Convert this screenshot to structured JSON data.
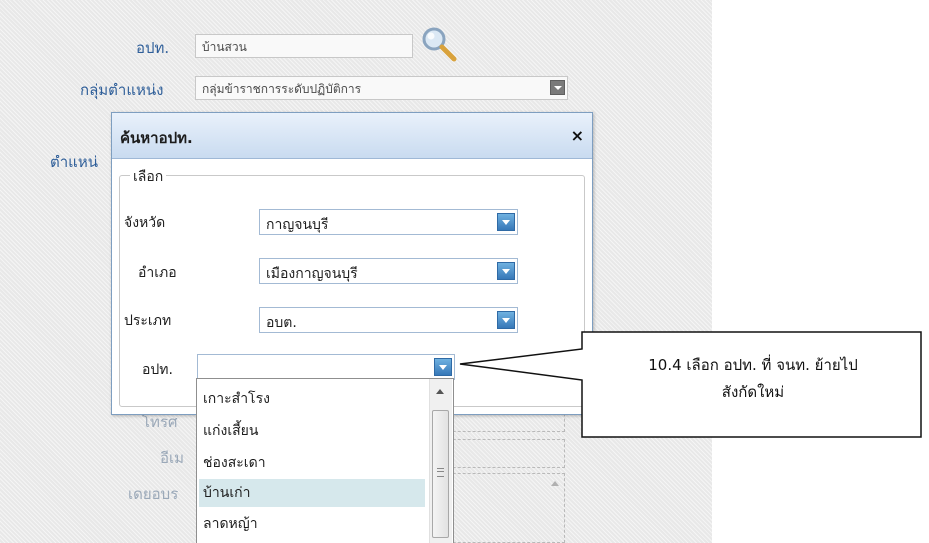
{
  "background_form": {
    "org_label": "อปท.",
    "org_value": "บ้านสวน",
    "position_group_label": "กลุ่มตำแหน่ง",
    "position_group_value": "กลุ่มข้าราชการระดับปฏิบัติการ",
    "position_label_partial": "ตำแหน่",
    "field_label_partial_1": "โทรศ",
    "field_label_partial_2": "อีเม",
    "field_label_partial_3": "เดยอบร"
  },
  "dialog": {
    "title": "ค้นหาอปท.",
    "close": "×",
    "fieldset_legend": "เลือก",
    "fields": {
      "province": {
        "label": "จังหวัด",
        "value": "กาญจนบุรี"
      },
      "district": {
        "label": "อำเภอ",
        "value": "เมืองกาญจนบุรี"
      },
      "type": {
        "label": "ประเภท",
        "value": "อบต."
      },
      "org": {
        "label": "อปท.",
        "value": ""
      }
    }
  },
  "dropdown": {
    "items": [
      "เกาะสำโรง",
      "แก่งเสี้ยน",
      "ช่องสะเดา",
      "บ้านเก่า",
      "ลาดหญ้า"
    ],
    "highlighted_index": 3
  },
  "callout": {
    "line1": "10.4  เลือก  อปท. ที่ จนท. ย้ายไป",
    "line2": "สังกัดใหม่"
  },
  "colors": {
    "label_blue": "#2e5e99",
    "dialog_header": "#c9dbf0",
    "select_button": "#3778b8",
    "highlight": "#d6e8ec"
  }
}
